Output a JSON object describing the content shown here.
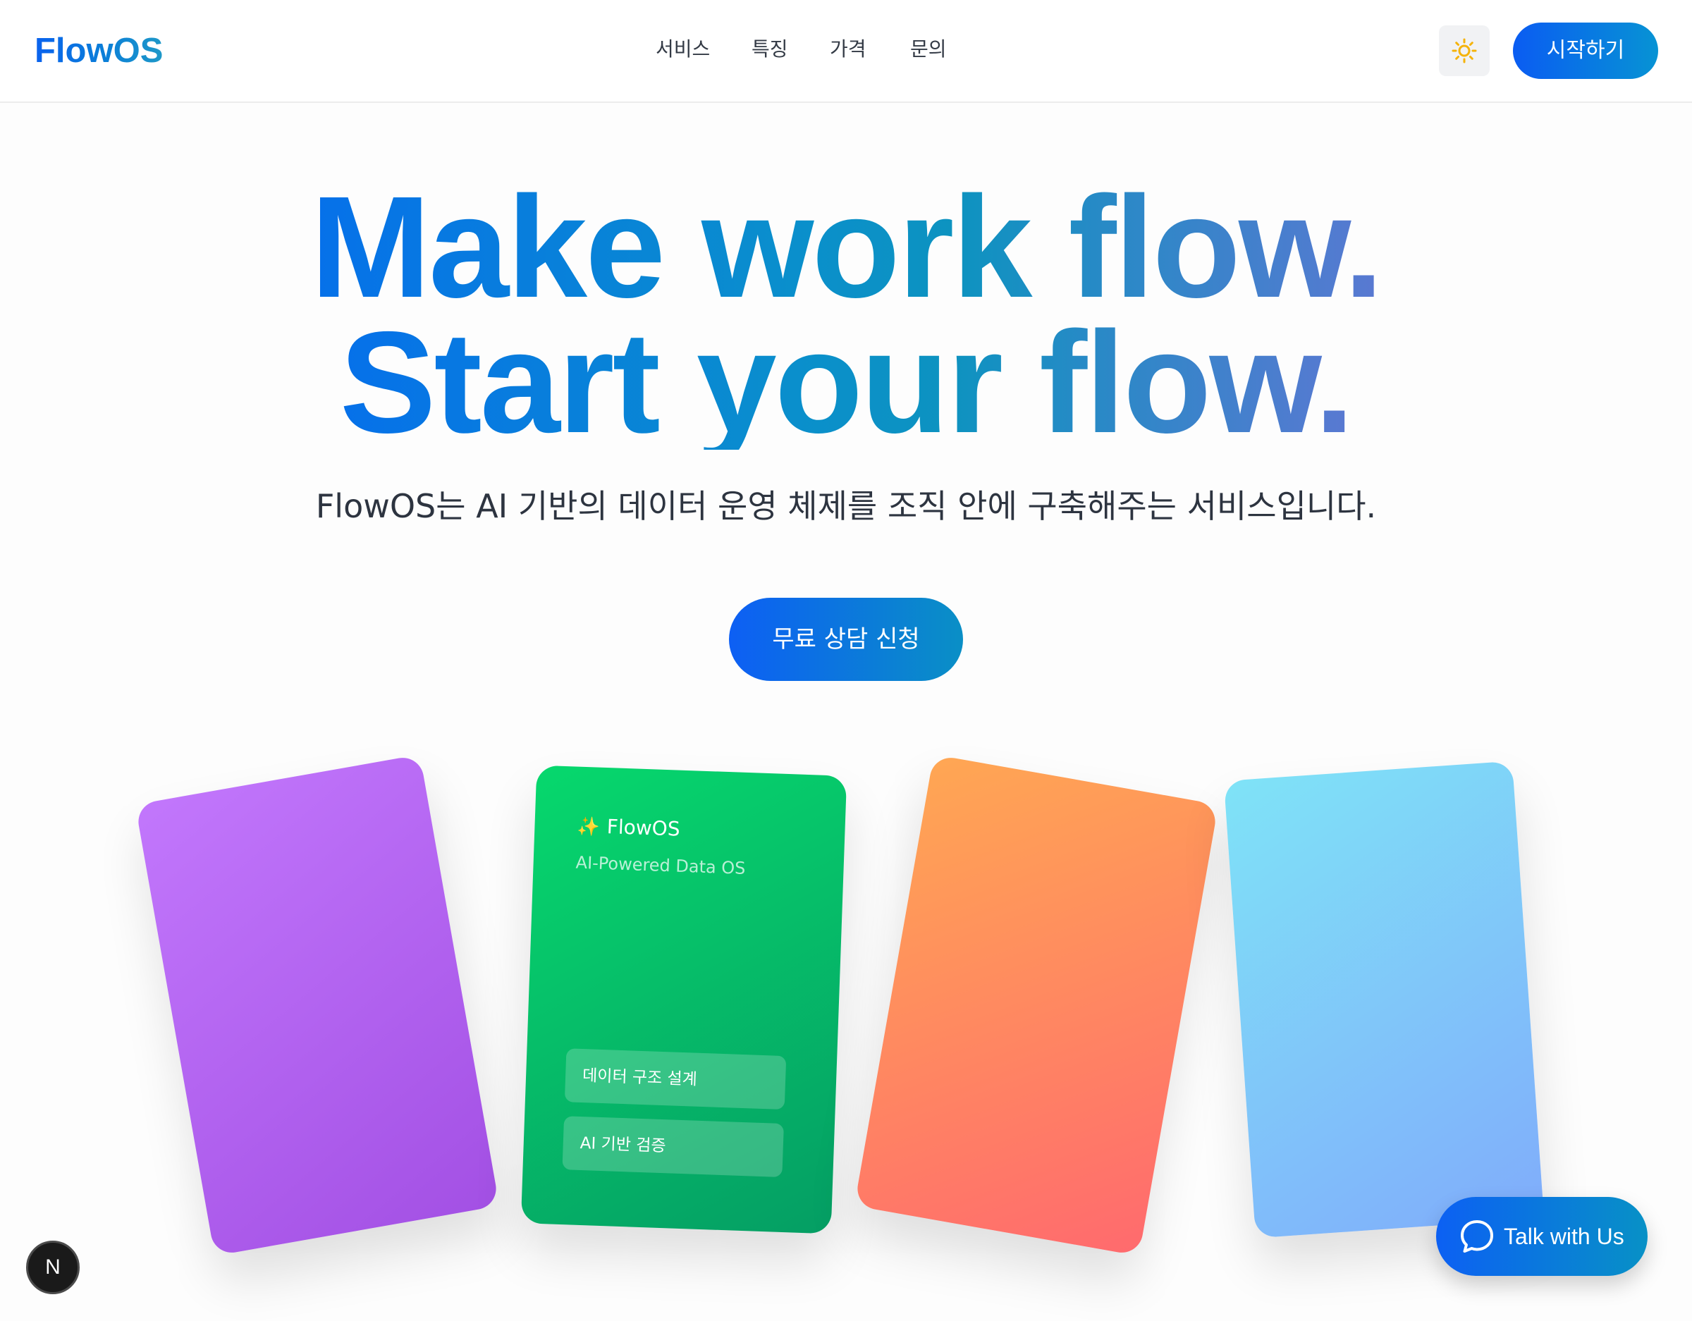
{
  "header": {
    "logo": "FlowOS",
    "nav": [
      "서비스",
      "특징",
      "가격",
      "문의"
    ],
    "theme_icon": "sun-icon",
    "start_label": "시작하기"
  },
  "hero": {
    "line1": "Make work flow.",
    "line2": "Start your flow.",
    "subtitle": "FlowOS는 AI 기반의 데이터 운영 체제를 조직 안에 구축해주는 서비스입니다.",
    "cta_label": "무료 상담 신청"
  },
  "cards": {
    "green": {
      "icon": "sparkles-icon",
      "sparkle": "✨",
      "title": "FlowOS",
      "subtitle": "AI-Powered Data OS",
      "chips": [
        "데이터 구조 설계",
        "AI 기반 검증"
      ]
    }
  },
  "floating": {
    "badge": "N",
    "talk_icon": "chat-bubble-icon",
    "talk_label": "Talk with Us"
  },
  "colors": {
    "accent": "#0a5cf2",
    "accent_teal": "#0793d4",
    "card_purple": "#b566f5",
    "card_green": "#03c468",
    "card_orange": "#ff8a60",
    "card_blue": "#7fc7fa"
  }
}
